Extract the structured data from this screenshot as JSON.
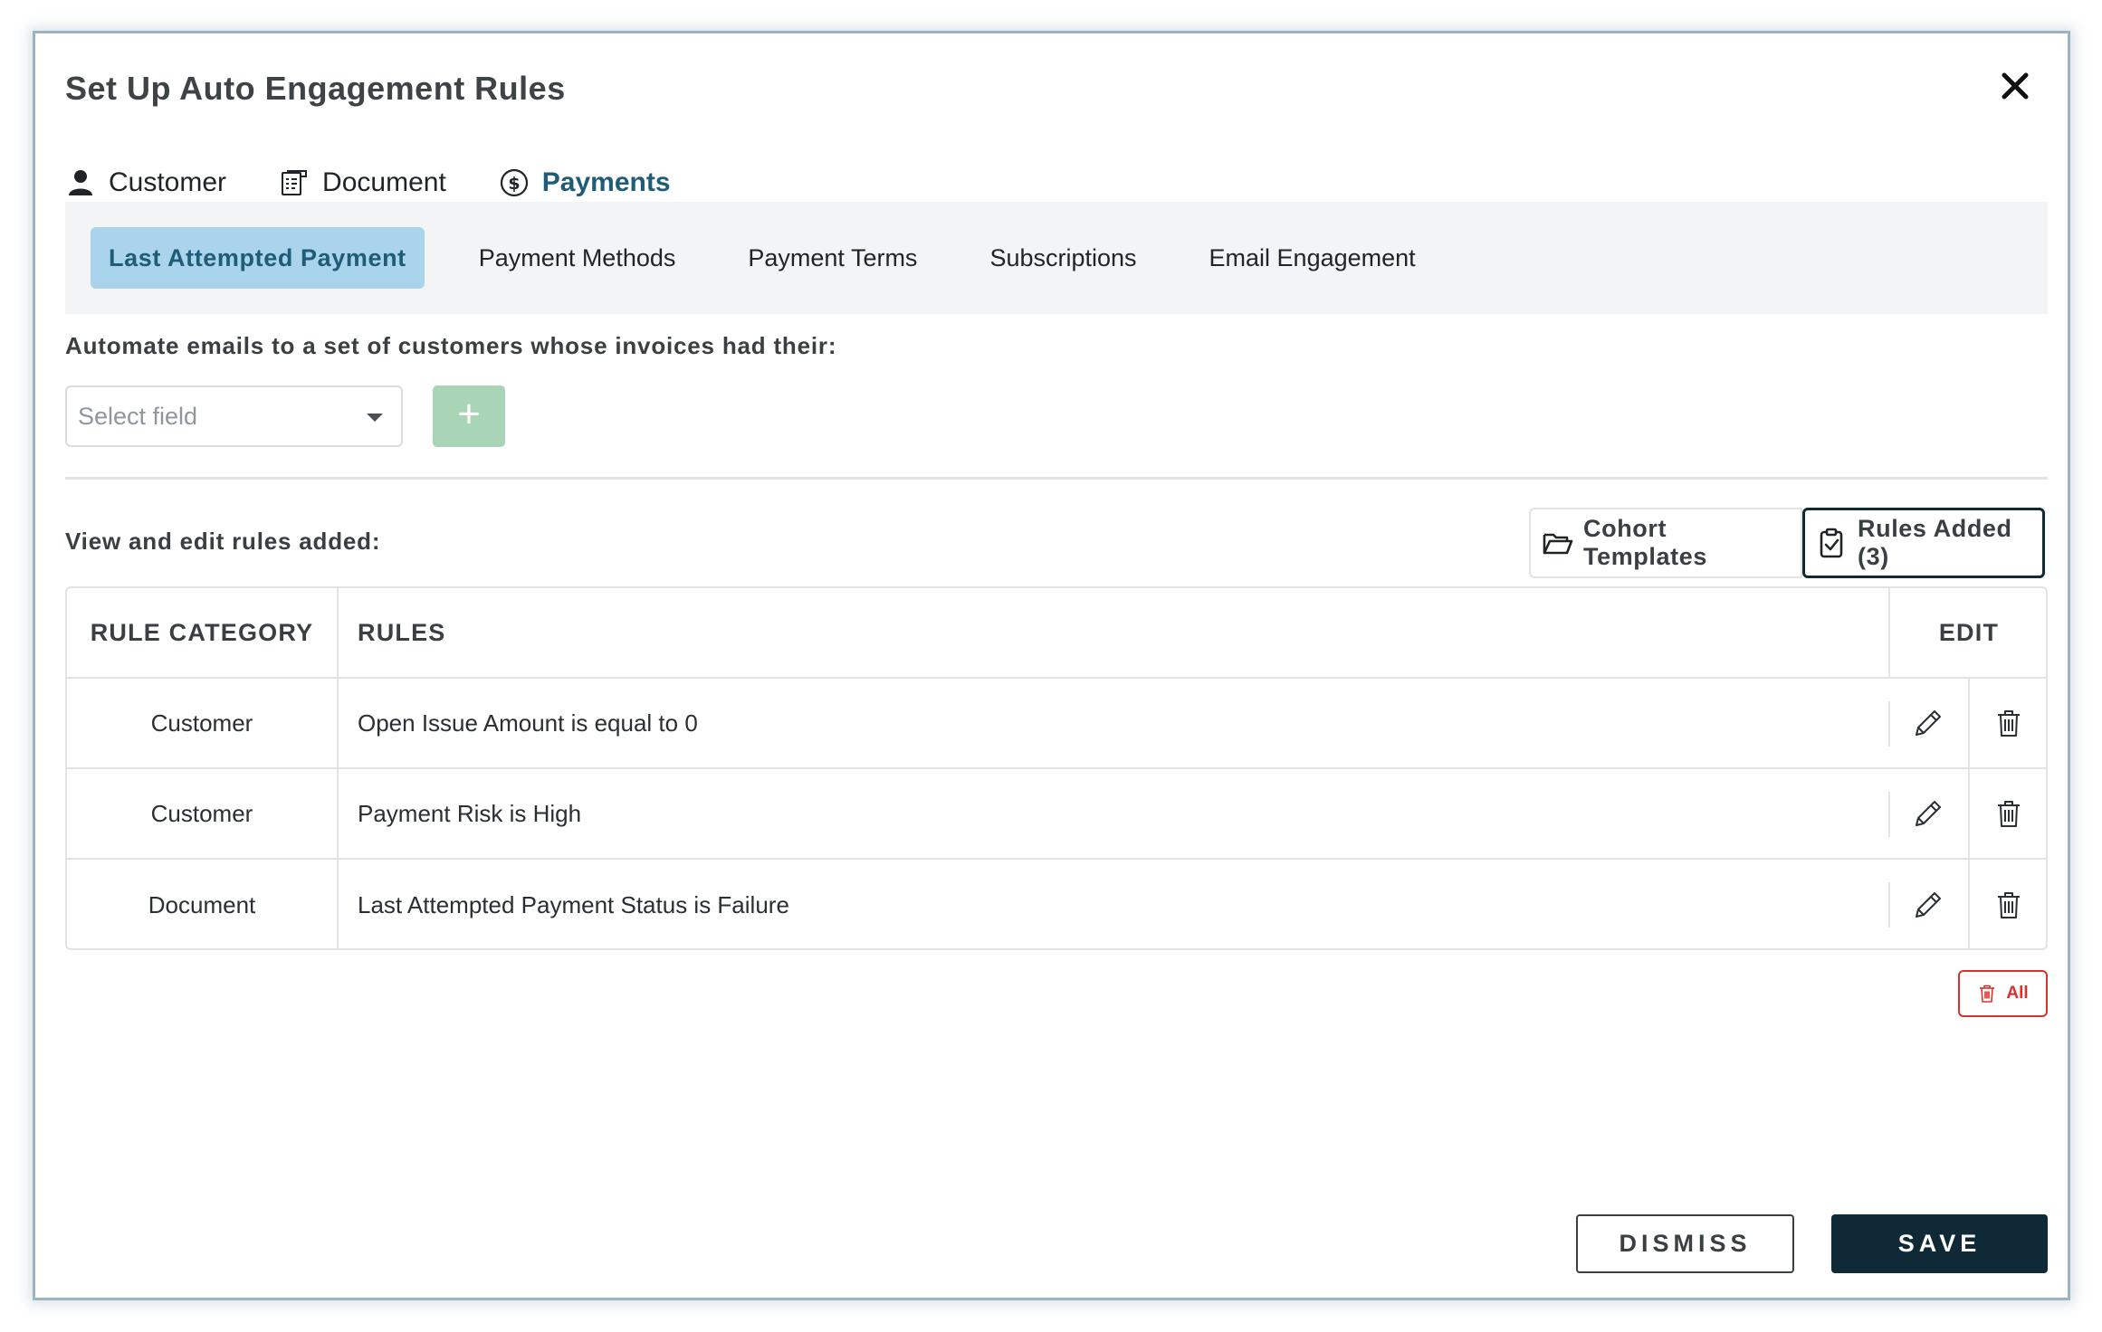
{
  "dialog": {
    "title": "Set Up Auto Engagement Rules"
  },
  "top_tabs": [
    {
      "label": "Customer",
      "icon": "user-icon",
      "active": false
    },
    {
      "label": "Document",
      "icon": "document-icon",
      "active": false
    },
    {
      "label": "Payments",
      "icon": "dollar-circle-icon",
      "active": true
    }
  ],
  "sub_tabs": [
    {
      "label": "Last Attempted Payment",
      "active": true
    },
    {
      "label": "Payment Methods",
      "active": false
    },
    {
      "label": "Payment Terms",
      "active": false
    },
    {
      "label": "Subscriptions",
      "active": false
    },
    {
      "label": "Email Engagement",
      "active": false
    }
  ],
  "automate": {
    "label": "Automate emails to a set of customers whose invoices had their:",
    "select_placeholder": "Select field",
    "add_symbol": "+"
  },
  "rules_section": {
    "label": "View and edit rules added:",
    "cohort_templates_label": "Cohort Templates",
    "rules_added_label": "Rules Added (3)"
  },
  "table": {
    "headers": {
      "category": "RULE CATEGORY",
      "rules": "RULES",
      "edit": "EDIT"
    },
    "rows": [
      {
        "category": "Customer",
        "rule": "Open Issue Amount is equal to 0"
      },
      {
        "category": "Customer",
        "rule": "Payment Risk is High"
      },
      {
        "category": "Document",
        "rule": "Last Attempted Payment Status is Failure"
      }
    ]
  },
  "delete_all_label": "All",
  "footer": {
    "dismiss_label": "DISMISS",
    "save_label": "SAVE"
  },
  "colors": {
    "primary_dark": "#0f2a36",
    "active_tab_text": "#1f5c78",
    "active_subtab_bg": "#a9d4ec",
    "add_button_bg": "#a8d5b6",
    "danger": "#d9322e"
  }
}
